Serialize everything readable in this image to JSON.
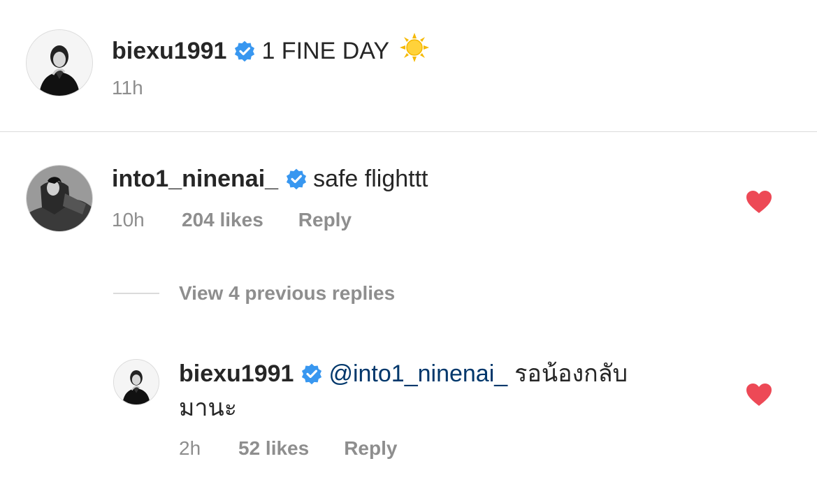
{
  "caption": {
    "username": "biexu1991",
    "text": "1 FINE DAY",
    "emoji": "sun-emoji",
    "time": "11h"
  },
  "comment": {
    "username": "into1_ninenai_",
    "text": "safe flighttt",
    "time": "10h",
    "likes": "204 likes",
    "reply": "Reply",
    "liked": true
  },
  "view_replies": "View 4 previous replies",
  "reply_comment": {
    "username": "biexu1991",
    "mention": "@into1_ninenai_",
    "text_line1": "รอน้องกลับ",
    "text_line2": "มานะ",
    "time": "2h",
    "likes": "52 likes",
    "reply": "Reply",
    "liked": true
  },
  "colors": {
    "verified": "#3897f0",
    "heart": "#ed4956",
    "meta": "#8e8e8e",
    "mention": "#00376b"
  }
}
